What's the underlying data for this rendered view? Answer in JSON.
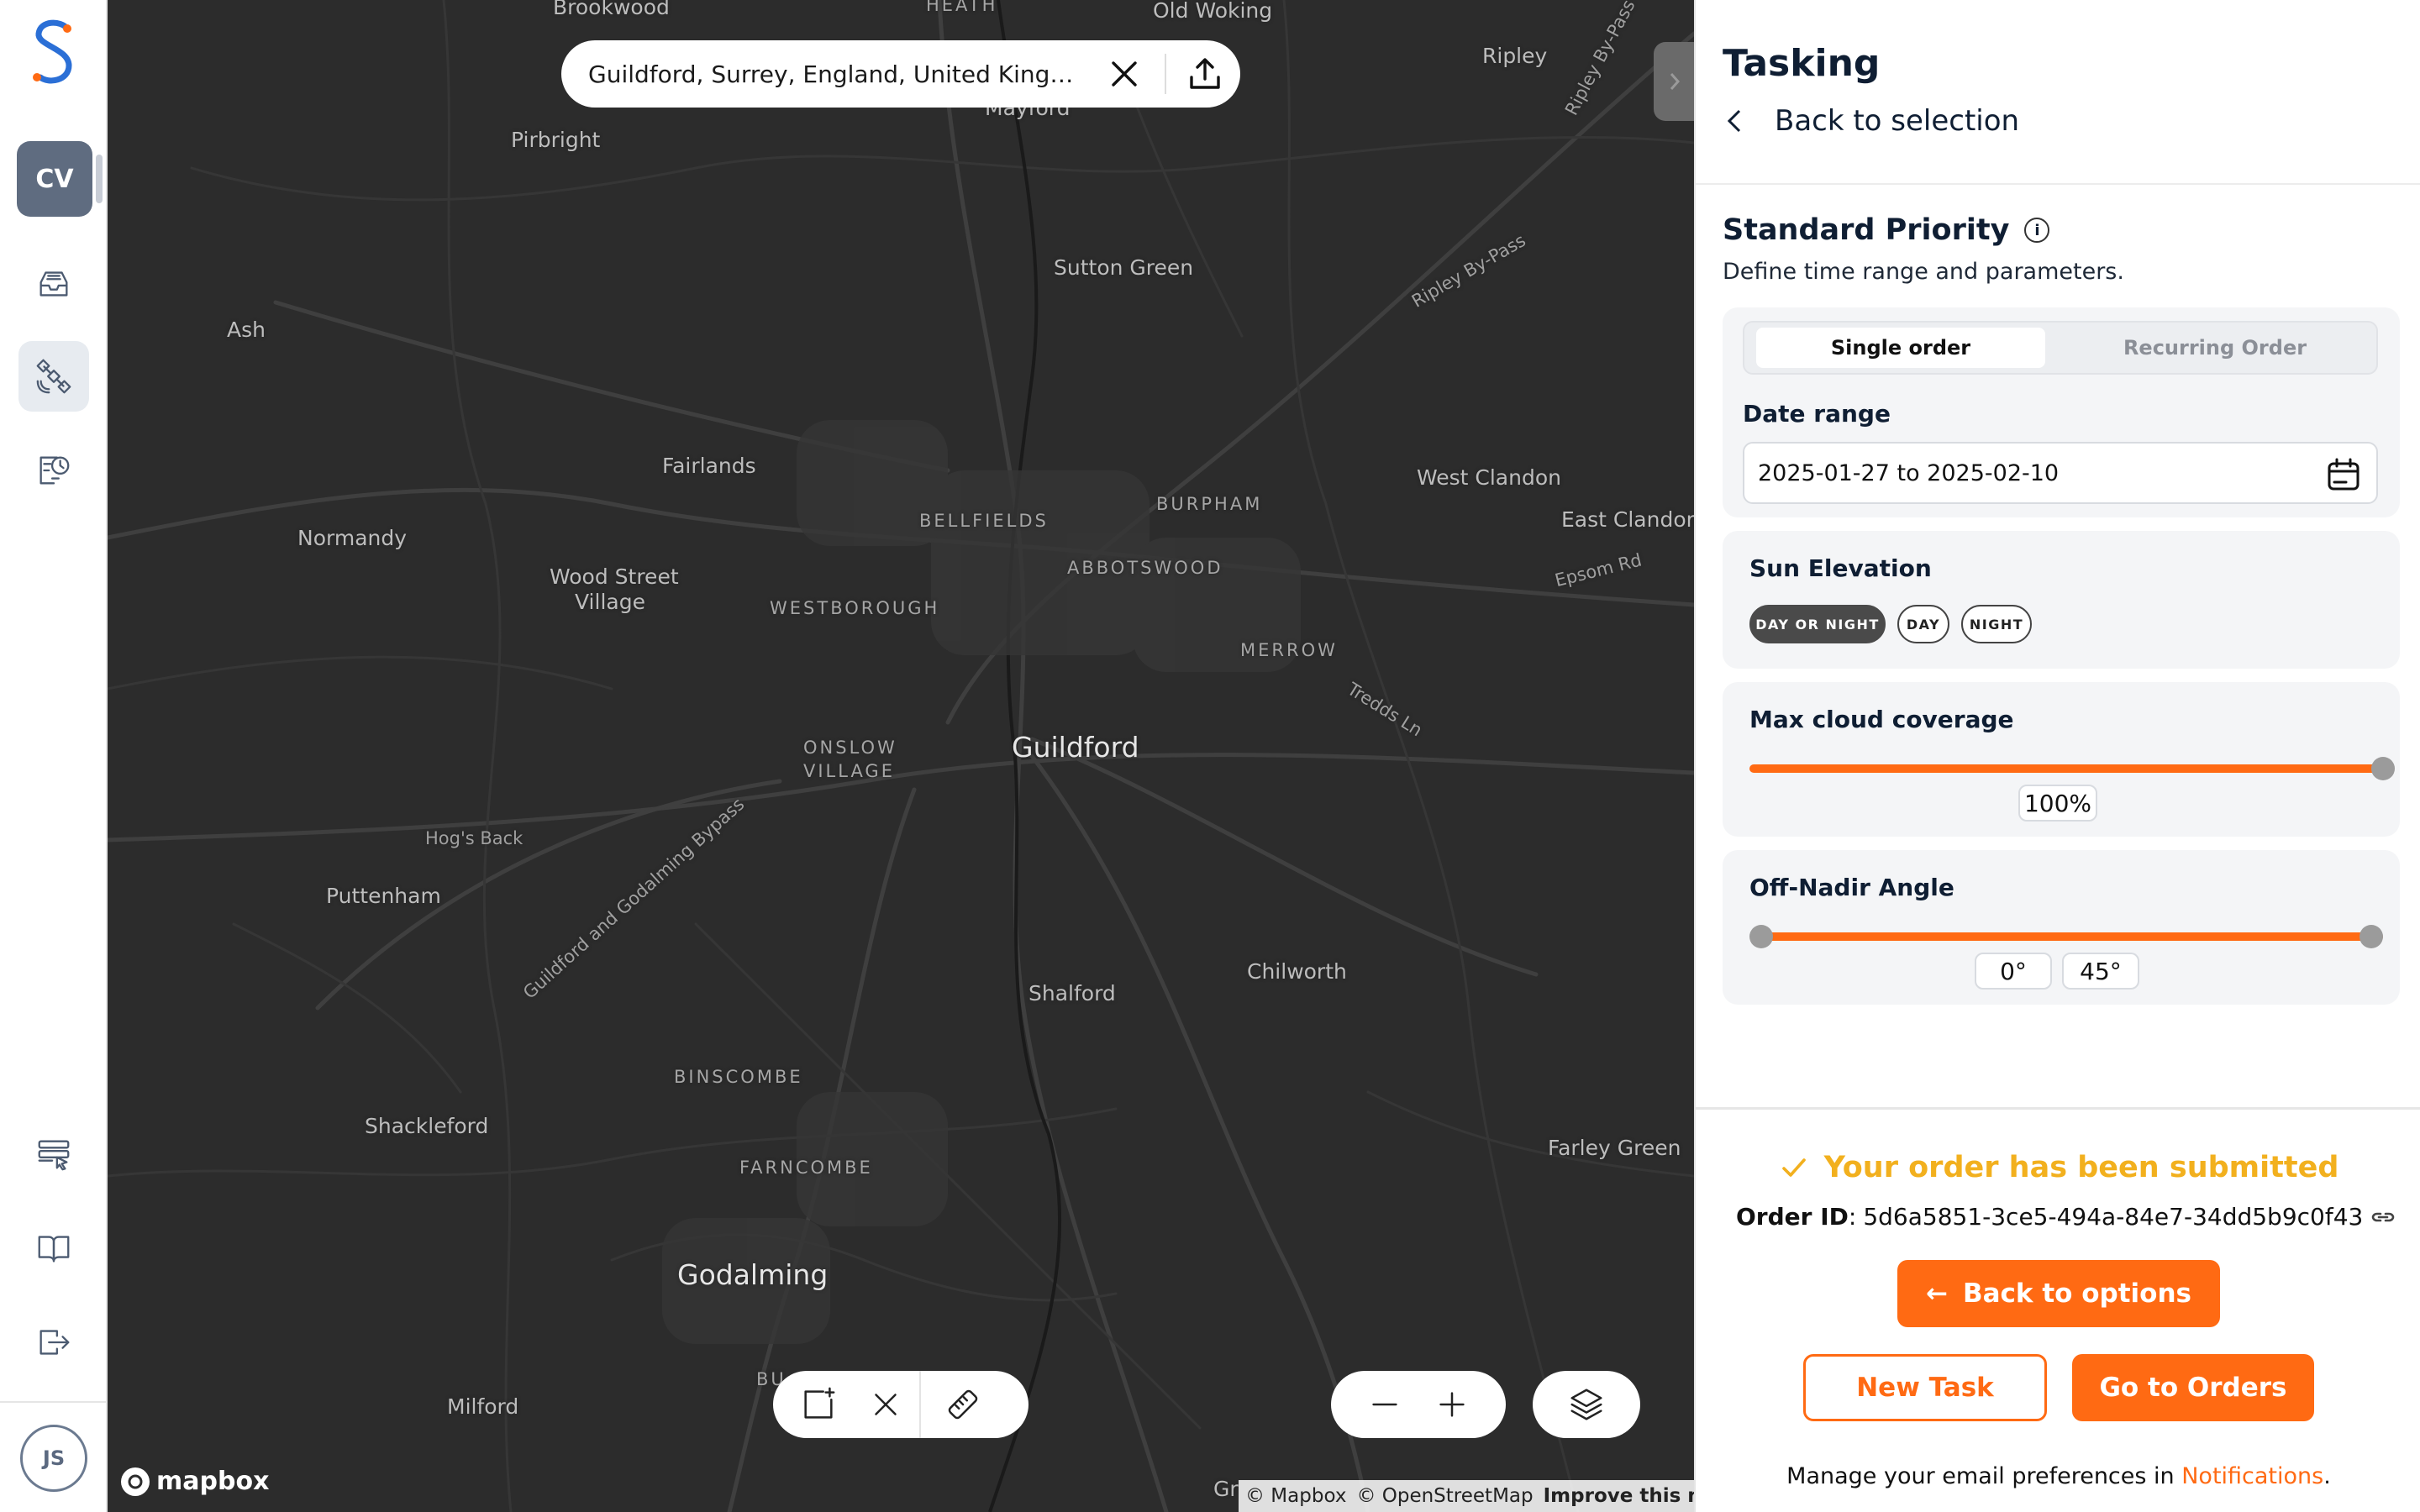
{
  "sidebar": {
    "workspace_initials": "CV",
    "user_initials": "JS",
    "items": [
      {
        "icon": "inbox-icon"
      },
      {
        "icon": "satellite-icon"
      },
      {
        "icon": "clock-report-icon"
      },
      {
        "icon": "list-cursor-icon"
      },
      {
        "icon": "book-icon"
      },
      {
        "icon": "logout-icon"
      }
    ]
  },
  "map": {
    "search_value": "Guildford, Surrey, England, United Kingd...",
    "places": [
      {
        "text": "Brookwood"
      },
      {
        "text": "HEATH"
      },
      {
        "text": "Old Woking"
      },
      {
        "text": "Ripley"
      },
      {
        "text": "Mayford"
      },
      {
        "text": "Pirbright"
      },
      {
        "text": "Ripley By-Pass"
      },
      {
        "text": "Sutton Green"
      },
      {
        "text": "Ash"
      },
      {
        "text": "Ripley By-Pass"
      },
      {
        "text": "Fairlands"
      },
      {
        "text": "West Clandon"
      },
      {
        "text": "BURPHAM"
      },
      {
        "text": "BELLFIELDS"
      },
      {
        "text": "East Clandon"
      },
      {
        "text": "Normandy"
      },
      {
        "text": "Epsom Rd"
      },
      {
        "text": "ABBOTSWOOD"
      },
      {
        "text": "Wood Street"
      },
      {
        "text": "Village"
      },
      {
        "text": "WESTBOROUGH"
      },
      {
        "text": "MERROW"
      },
      {
        "text": "Tredds Ln"
      },
      {
        "text": "ONSLOW"
      },
      {
        "text": "VILLAGE"
      },
      {
        "text": "Guildford"
      },
      {
        "text": "Hog's Back"
      },
      {
        "text": "Guildford and Godalming Bypass"
      },
      {
        "text": "Puttenham"
      },
      {
        "text": "Chilworth"
      },
      {
        "text": "Shalford"
      },
      {
        "text": "BINSCOMBE"
      },
      {
        "text": "Shackleford"
      },
      {
        "text": "Farley Green"
      },
      {
        "text": "FARNCOMBE"
      },
      {
        "text": "Godalming"
      },
      {
        "text": "BU"
      },
      {
        "text": "Milford"
      },
      {
        "text": "Gr"
      }
    ],
    "mapbox": "mapbox",
    "attribution": {
      "mapbox": "© Mapbox",
      "osm": "© OpenStreetMap",
      "improve": "Improve this map"
    }
  },
  "panel": {
    "title": "Tasking",
    "back_label": "Back to selection",
    "priority_title": "Standard Priority",
    "priority_sub": "Define time range and parameters.",
    "order_types": {
      "single": "Single order",
      "recurring": "Recurring Order",
      "selected": "Single order"
    },
    "date_range": {
      "label": "Date range",
      "value": "2025-01-27 to 2025-02-10"
    },
    "sun": {
      "label": "Sun Elevation",
      "options": [
        "DAY OR NIGHT",
        "DAY",
        "NIGHT"
      ],
      "selected": "DAY OR NIGHT"
    },
    "cloud": {
      "label": "Max cloud coverage",
      "value": "100%",
      "level": 1.0
    },
    "nadir": {
      "label": "Off-Nadir Angle",
      "min": "0°",
      "max": "45°",
      "range": [
        0,
        45
      ]
    },
    "submitted_msg": "Your order has been submitted",
    "order_id_label": "Order ID",
    "order_id_sep": ":",
    "order_id": "5d6a5851-3ce5-494a-84e7-34dd5b9c0f43",
    "back_options": "Back to options",
    "new_task": "New Task",
    "go_orders": "Go to Orders",
    "email_pref_prefix": "Manage your email preferences in ",
    "email_pref_link": "Notifications",
    "email_pref_suffix": "."
  },
  "colors": {
    "accent": "#ff6a13",
    "success": "#f2b01e",
    "map_bg": "#2c2c2c",
    "brand_blue": "#2b6fd6"
  }
}
